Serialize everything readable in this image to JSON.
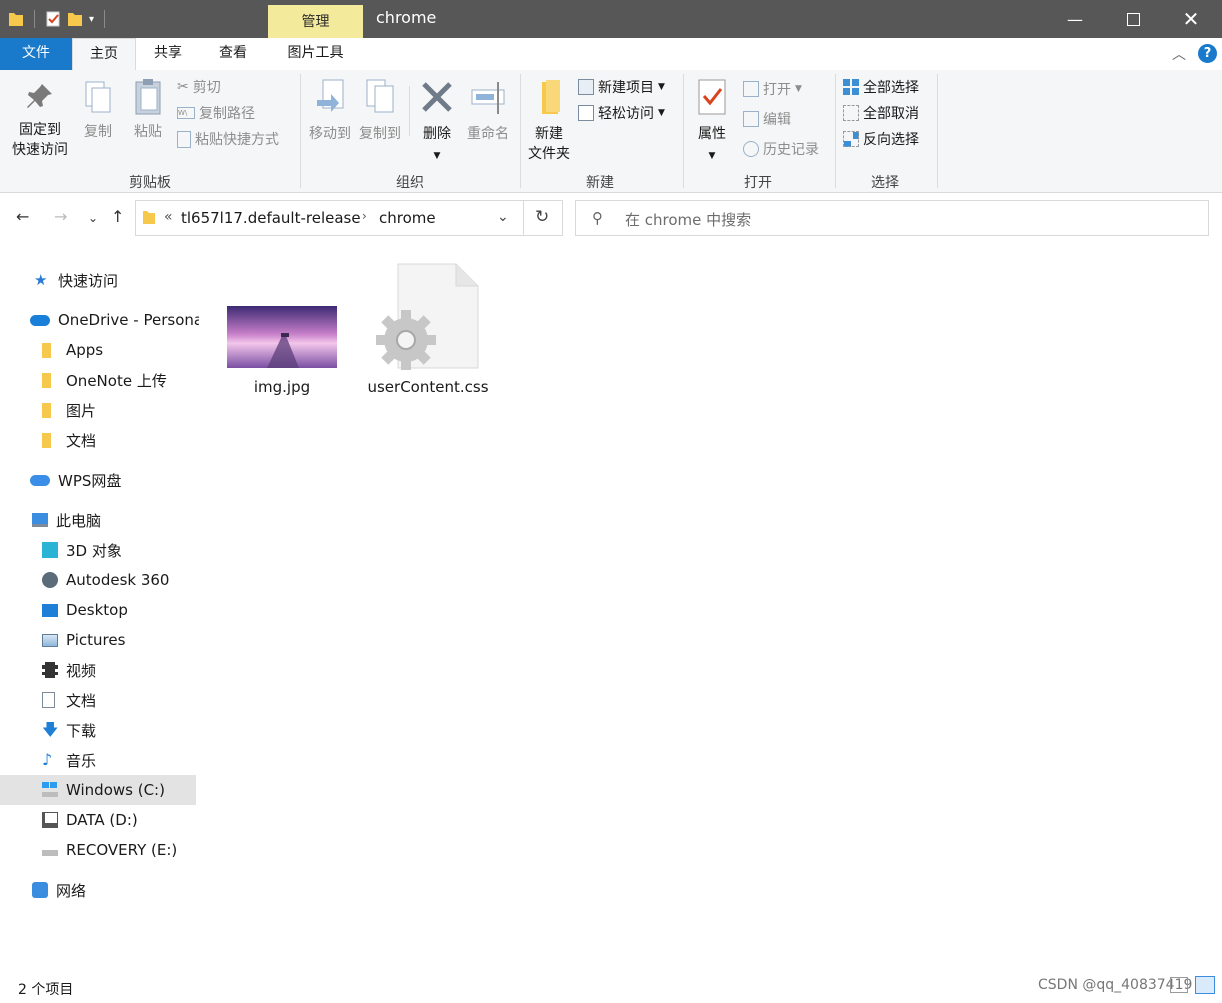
{
  "window": {
    "title": "chrome",
    "contextual_tab": "管理",
    "controls": [
      "minimize",
      "maximize",
      "close"
    ]
  },
  "ribbon_tabs": {
    "file": "文件",
    "home": "主页",
    "share": "共享",
    "view": "查看",
    "picture_tools": "图片工具"
  },
  "ribbon": {
    "clipboard": {
      "label": "剪贴板",
      "pin_line1": "固定到",
      "pin_line2": "快速访问",
      "copy": "复制",
      "paste": "粘贴",
      "cut": "剪切",
      "copy_path": "复制路径",
      "paste_shortcut": "粘贴快捷方式"
    },
    "organize": {
      "label": "组织",
      "move_to": "移动到",
      "copy_to": "复制到",
      "delete": "删除",
      "rename": "重命名"
    },
    "new": {
      "label": "新建",
      "new_folder_line1": "新建",
      "new_folder_line2": "文件夹",
      "new_item": "新建项目",
      "easy_access": "轻松访问"
    },
    "open": {
      "label": "打开",
      "properties": "属性",
      "open": "打开",
      "edit": "编辑",
      "history": "历史记录"
    },
    "select": {
      "label": "选择",
      "select_all": "全部选择",
      "select_none": "全部取消",
      "invert": "反向选择"
    }
  },
  "address": {
    "overflow": "«",
    "crumbs": [
      "tl657l17.default-release",
      "chrome"
    ],
    "search_placeholder": "在 chrome 中搜索"
  },
  "navpane": {
    "quick_access": "快速访问",
    "onedrive": "OneDrive - Persona",
    "onedrive_items": [
      "Apps",
      "OneNote 上传",
      "图片",
      "文档"
    ],
    "wps": "WPS网盘",
    "this_pc": "此电脑",
    "pc_items": [
      "3D 对象",
      "Autodesk 360",
      "Desktop",
      "Pictures",
      "视频",
      "文档",
      "下载",
      "音乐",
      "Windows (C:)",
      "DATA (D:)",
      "RECOVERY (E:)"
    ],
    "network": "网络"
  },
  "files": [
    {
      "name": "img.jpg",
      "type": "image"
    },
    {
      "name": "userContent.css",
      "type": "css"
    }
  ],
  "status": {
    "count": "2 个项目",
    "watermark": "CSDN @qq_40837419"
  },
  "colors": {
    "titlebar": "#575757",
    "file_tab": "#1979ca",
    "manage_tab": "#f3ea9b",
    "selection": "#e3e3e3",
    "folder": "#f6c94c"
  }
}
